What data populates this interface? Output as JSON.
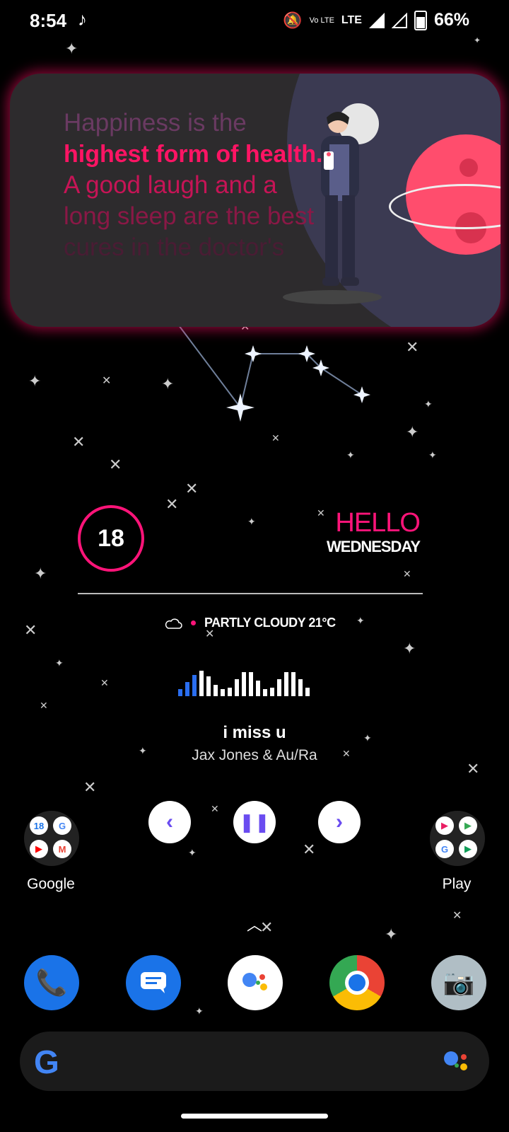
{
  "status_bar": {
    "time": "8:54",
    "music_icon": "music-note-icon",
    "volte": "Vo LTE",
    "lte": "LTE",
    "battery": "66%"
  },
  "quote_widget": {
    "line1": "Happiness is the",
    "line2": "highest form of health.",
    "line3": "A good laugh and a",
    "line4": "long sleep are the best",
    "line5": "cures in the doctor's"
  },
  "clock_widget": {
    "day": "18",
    "greeting": "HELLO",
    "weekday": "WEDNESDAY",
    "weather": "PARTLY CLOUDY 21°C",
    "accent": "#ff1479"
  },
  "music_widget": {
    "title": "i miss u",
    "artist": "Jax Jones & Au/Ra",
    "prev_icon": "chevron-left-icon",
    "pause_icon": "pause-icon",
    "next_icon": "chevron-right-icon"
  },
  "home": {
    "folder_left_label": "Google",
    "folder_right_label": "Play"
  },
  "dock": {
    "apps": [
      "Phone",
      "Messages",
      "Assistant",
      "Chrome",
      "Camera"
    ]
  },
  "search": {
    "logo": "G"
  }
}
